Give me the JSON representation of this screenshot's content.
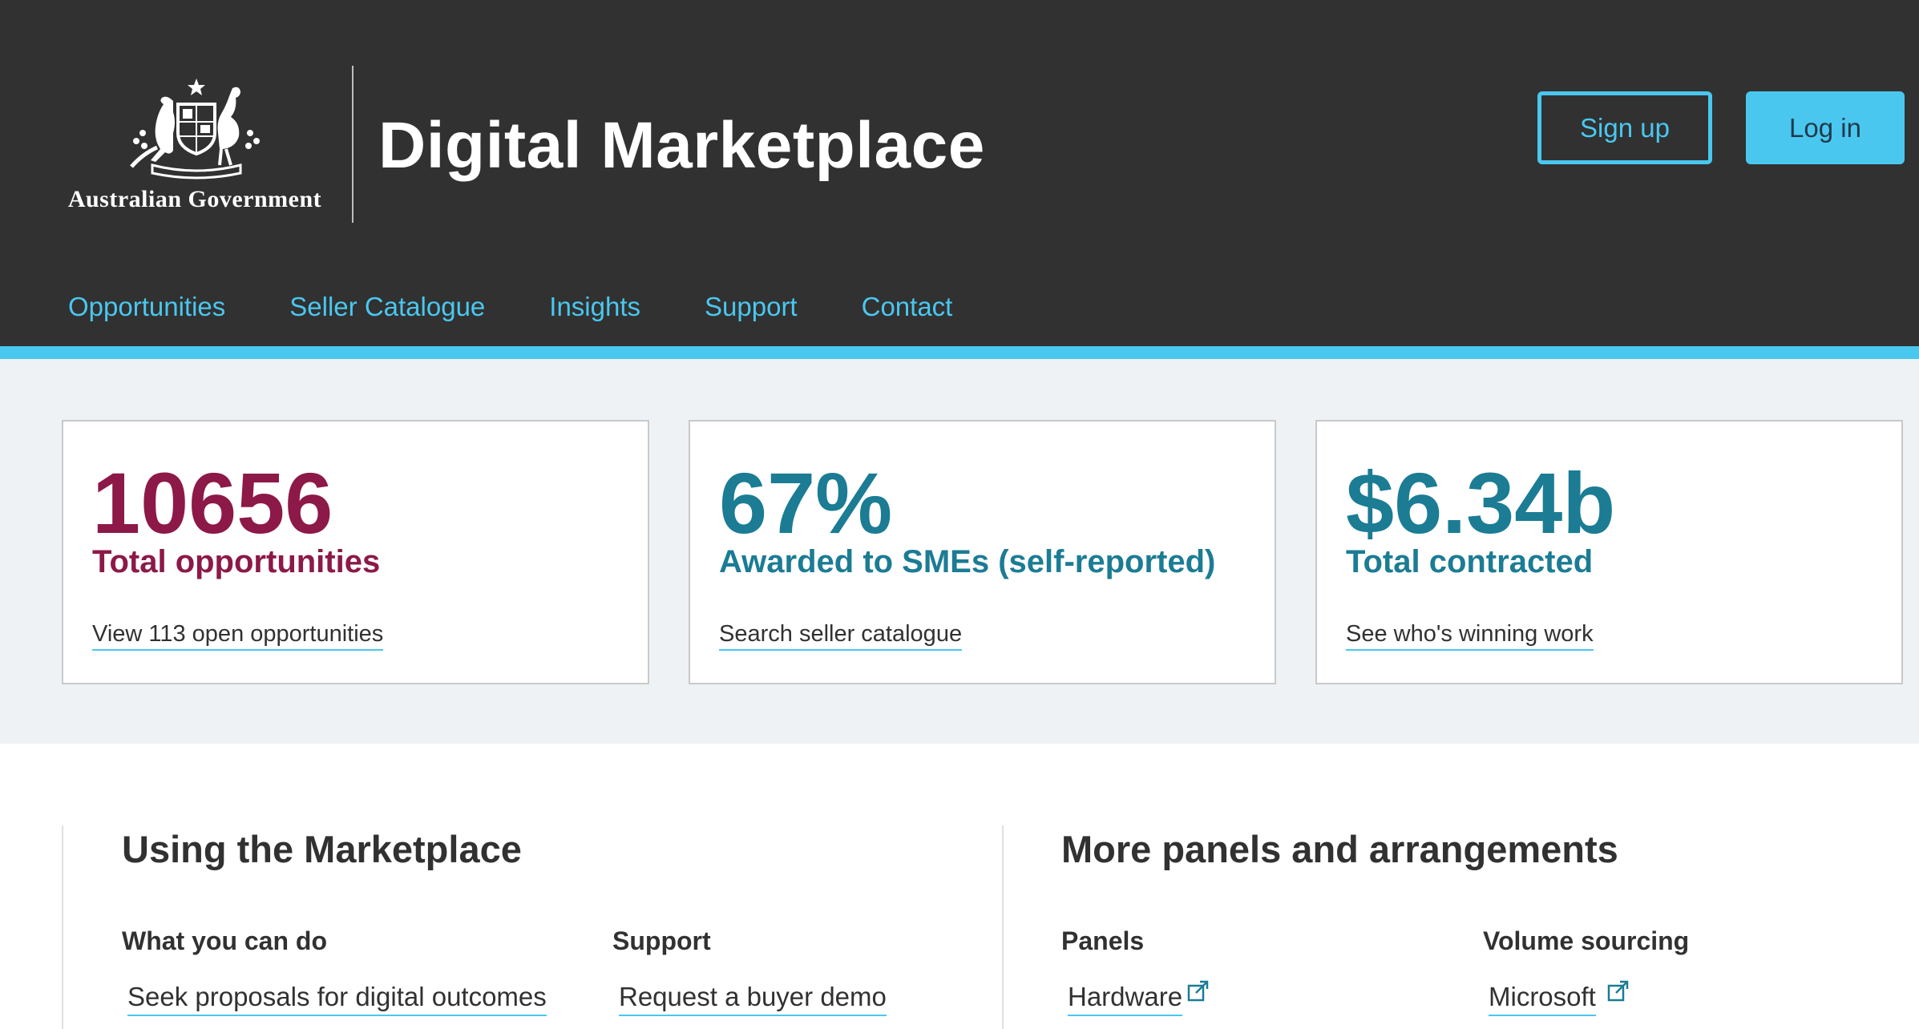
{
  "header": {
    "government_name": "Australian Government",
    "site_title": "Digital Marketplace",
    "signup_label": "Sign up",
    "login_label": "Log in",
    "bg_color": "#313131",
    "accent_color": "#4ac7ef"
  },
  "nav": {
    "items": [
      "Opportunities",
      "Seller Catalogue",
      "Insights",
      "Support",
      "Contact"
    ]
  },
  "stats": [
    {
      "value": "10656",
      "label": "Total opportunities",
      "link": "View 113 open opportunities",
      "color": "#8c1948"
    },
    {
      "value": "67%",
      "label": "Awarded to SMEs (self-reported)",
      "link": "Search seller catalogue",
      "color": "#1b7c94"
    },
    {
      "value": "$6.34b",
      "label": "Total contracted",
      "link": "See who's winning work",
      "color": "#1b7c94"
    }
  ],
  "using": {
    "heading": "Using the Marketplace",
    "what_heading": "What you can do",
    "what_links": [
      "Seek proposals for digital outcomes"
    ],
    "support_heading": "Support",
    "support_links": [
      "Request a buyer demo"
    ]
  },
  "panels": {
    "heading": "More panels and arrangements",
    "panels_heading": "Panels",
    "panels_links": [
      "Hardware"
    ],
    "volume_heading": "Volume sourcing",
    "volume_links": [
      "Microsoft"
    ]
  }
}
